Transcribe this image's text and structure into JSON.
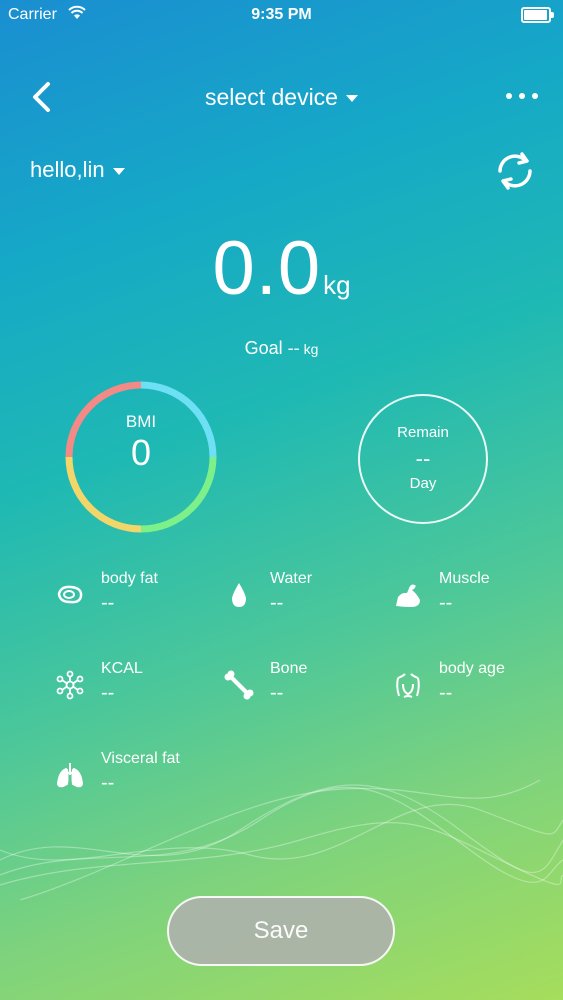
{
  "status_bar": {
    "carrier": "Carrier",
    "time": "9:35 PM"
  },
  "nav": {
    "device_label": "select device"
  },
  "user": {
    "greeting": "hello,lin"
  },
  "weight": {
    "value": "0.0",
    "unit": "kg"
  },
  "goal": {
    "label": "Goal",
    "value": "--",
    "unit": "kg"
  },
  "bmi": {
    "label": "BMI",
    "value": "0",
    "ring_colors": [
      "#6ee0f5",
      "#7ef08a",
      "#f3d66a",
      "#f38a86"
    ]
  },
  "remain": {
    "label": "Remain",
    "value": "--",
    "unit": "Day"
  },
  "metrics": [
    {
      "icon": "meat-icon",
      "label": "body fat",
      "value": "--"
    },
    {
      "icon": "water-drop-icon",
      "label": "Water",
      "value": "--"
    },
    {
      "icon": "muscle-arm-icon",
      "label": "Muscle",
      "value": "--"
    },
    {
      "icon": "molecule-icon",
      "label": "KCAL",
      "value": "--"
    },
    {
      "icon": "bone-icon",
      "label": "Bone",
      "value": "--"
    },
    {
      "icon": "body-outline-icon",
      "label": "body age",
      "value": "--"
    },
    {
      "icon": "lungs-icon",
      "label": "Visceral fat",
      "value": "--"
    }
  ],
  "save_button": {
    "label": "Save"
  }
}
